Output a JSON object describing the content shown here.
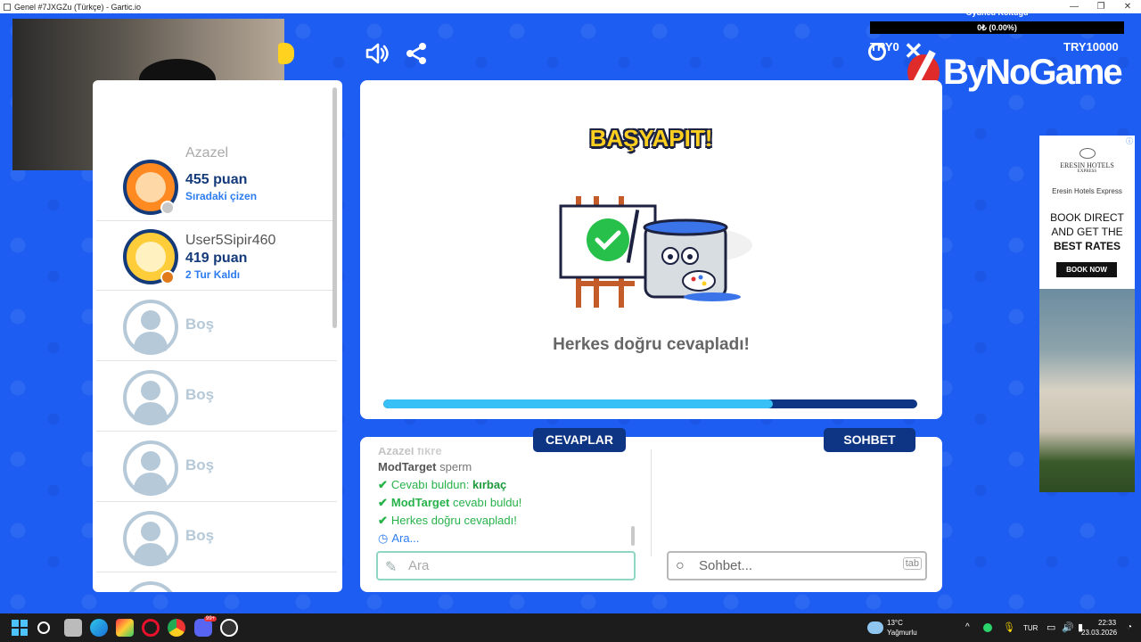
{
  "window": {
    "title": "Genel #7JXGZu (Türkçe) - Gartic.io",
    "minimize": "—",
    "maximize": "❐",
    "close": "✕"
  },
  "stream": {
    "seat_title": "Oyuncu Koltuğu",
    "seat_value": "0₺ (0.00%)",
    "try_left": "TRY0",
    "try_right": "TRY10000",
    "sponsor": "ByNoGame"
  },
  "players": [
    {
      "name": "Azazel",
      "points": "455 puan",
      "status": "Sıradaki çizen",
      "dot_color": "#c8c8c8",
      "avatar": "orange"
    },
    {
      "name": "User5Sipir460",
      "points": "419 puan",
      "status": "2 Tur Kaldı",
      "dot_color": "#e07a1a",
      "avatar": "full"
    },
    {
      "name": "Boş"
    },
    {
      "name": "Boş"
    },
    {
      "name": "Boş"
    },
    {
      "name": "Boş"
    }
  ],
  "main": {
    "banner": "BAŞYAPIT!",
    "message": "Herkes doğru cevapladı!",
    "progress": 0.73,
    "colors": {
      "panel": "#ffffff",
      "progress_track": "#0e3584",
      "progress_fill": "#36c0f5"
    }
  },
  "tabs": {
    "answers": "CEVAPLAR",
    "chat": "SOHBET"
  },
  "answers": {
    "faded_name": "Azazel",
    "faded_text": "fikre",
    "line1_name": "ModTarget",
    "line1_text": "sperm",
    "found_prefix": "Cevabı buldun:",
    "found_word": "kırbaç",
    "found_name": "ModTarget",
    "found_suffix": "cevabı buldu!",
    "all_correct": "Herkes doğru cevapladı!",
    "waiting": "Ara..."
  },
  "inputs": {
    "answer_placeholder": "Ara",
    "chat_placeholder": "Sohbet...",
    "chat_hint": "tab"
  },
  "ad": {
    "brand": "ERESIN HOTELS",
    "brand_small": "EXPRESS",
    "subtitle": "Eresin Hotels Express",
    "headline_1": "BOOK DIRECT",
    "headline_2": "AND GET THE",
    "headline_3": "BEST RATES",
    "button": "BOOK NOW",
    "adchoice": "ⓘ"
  },
  "taskbar": {
    "weather_temp": "13°C",
    "weather_text": "Yağmurlu",
    "lang": "TUR",
    "time": "22:33",
    "date": "23.03.2026",
    "notification_badge": "99+"
  },
  "icons": {
    "sound": "speaker-icon",
    "share": "share-icon",
    "timer": "timer-icon",
    "close": "close-icon",
    "pencil": "pencil-icon",
    "search": "search-icon",
    "check": "check-icon",
    "clock": "clock-icon"
  }
}
